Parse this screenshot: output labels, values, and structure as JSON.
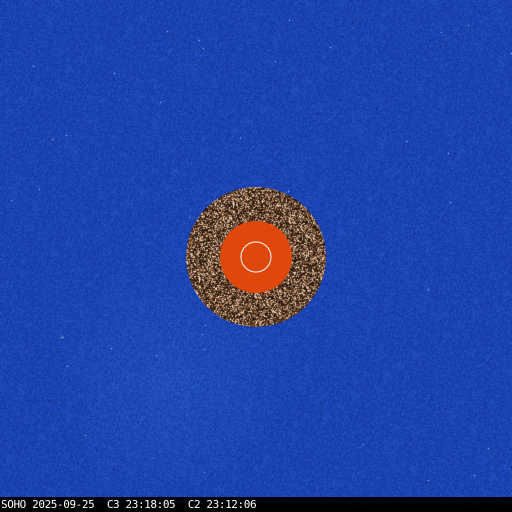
{
  "caption": {
    "observatory": "SOHO",
    "date": "2025-09-25",
    "c3_label": "C3",
    "c3_time": "23:18:05",
    "c2_label": "C2",
    "c2_time": "23:12:06"
  },
  "colors": {
    "background_blue": "#1b45b3",
    "occulter_orange": "#e0470b",
    "sun_outline": "#ffffff",
    "ring_dark": "#2a1a10"
  }
}
